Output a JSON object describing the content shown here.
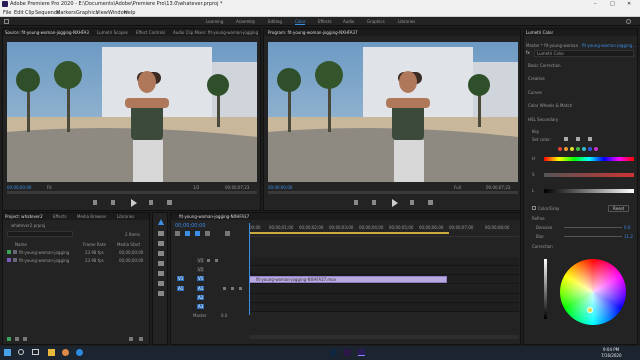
{
  "window": {
    "title": "Adobe Premiere Pro 2020 - E:\\Documents\\Adobe\\Premiere Pro\\13.0\\whatever.prproj *",
    "controls": [
      "–",
      "□",
      "✕"
    ]
  },
  "menu": [
    "File",
    "Edit",
    "Clip",
    "Sequence",
    "Markers",
    "Graphics",
    "View",
    "Window",
    "Help"
  ],
  "workspaces": [
    "Learning",
    "Assembly",
    "Editing",
    "Color",
    "Effects",
    "Audio",
    "Graphics",
    "Libraries"
  ],
  "active_workspace": "Color",
  "source_tabs": [
    "Source: fit-young-woman-jogging-NXHFA37.mov",
    "Lumetri Scopes",
    "Effect Controls",
    "Audio Clip Mixer: fit-young-woman-jogging"
  ],
  "program_tab": "Program: fit-young-woman-jogging-NXHFA37",
  "source_timecode": "00;00;00;00",
  "source_fit": "Fit",
  "source_zoom": "1/2",
  "source_duration": "00;00;07;23",
  "program_timecode": "00;00;00;00",
  "program_fit": "Full",
  "program_duration": "00;00;07;23",
  "project": {
    "tabs": [
      "Project: whatever2",
      "Effects",
      "Media Browser",
      "Libraries"
    ],
    "file": "whatever2.prproj",
    "items_count": "2 Items",
    "headers": [
      "Name",
      "Frame Rate",
      "Media Start"
    ],
    "rows": [
      {
        "name": "fit-young-woman-jogging",
        "fps": "23.98 fps",
        "start": "00;00;00;00"
      },
      {
        "name": "fit-young-woman-jogging",
        "fps": "23.98 fps",
        "start": "00;00;00;00"
      }
    ]
  },
  "timeline": {
    "tab": "fit-young-woman-jogging-NXHFA37",
    "timecode": "00;00;00;00",
    "ruler": [
      "00;00",
      "00;00;01;00",
      "00;00;02;00",
      "00;00;03;00",
      "00;00;04;00",
      "00;00;05;00",
      "00;00;06;00",
      "00;00;07;00",
      "00;00;08;00"
    ],
    "tracks": [
      "V3",
      "V2",
      "V1",
      "A1",
      "A2",
      "A3"
    ],
    "source_labels": [
      "V1",
      "A1"
    ],
    "clip": "fit-young-woman-jogging-NXHFA37.mov",
    "master": "Master",
    "master_val": "0.0"
  },
  "lumetri": {
    "title": "Lumetri Color",
    "master": "Master * fit-young-woman...",
    "clip": "fit-young-woman-jogging...",
    "fx": "Lumetri Color",
    "sections": [
      "Basic Correction",
      "Creative",
      "Curves",
      "Color Wheels & Match",
      "HSL Secondary"
    ],
    "key": "Key",
    "set_color": "Set color:",
    "hsl": [
      "H",
      "S",
      "L"
    ],
    "color_gray": "Color/Gray",
    "reset": "Reset",
    "refine": "Refine",
    "denoise": "Denoise",
    "denoise_val": "0.0",
    "blur": "Blur",
    "blur_val": "11.2",
    "correction": "Correction"
  },
  "clock": {
    "time": "9:04 PM",
    "date": "7/16/2020"
  },
  "colors": {
    "accent": "#3a8ee6",
    "clip": "#b8a9e0",
    "workspace_active": "#3a8ee6"
  }
}
